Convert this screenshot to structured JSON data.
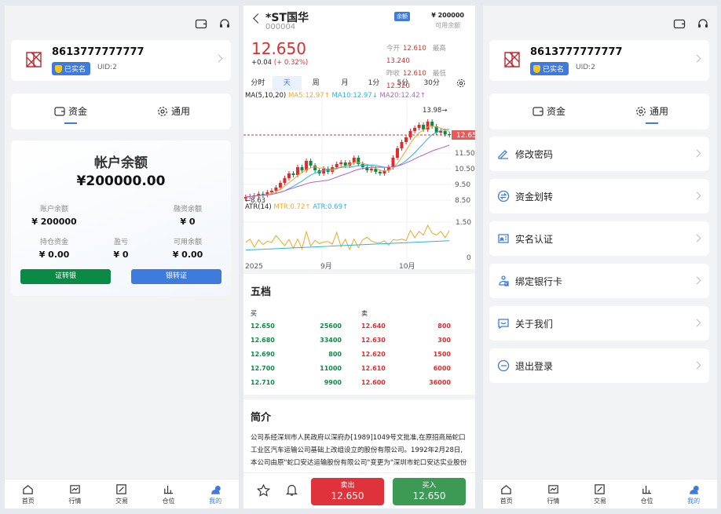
{
  "profile": {
    "phone": "8613777777777",
    "verified": "已实名",
    "uid": "UID:2"
  },
  "tabs": {
    "funds": "资金",
    "general": "通用"
  },
  "balance": {
    "title": "帐户余额",
    "value": "¥200000.00",
    "cells": [
      {
        "label": "账户余额",
        "value": "¥ 200000"
      },
      {
        "label": "融资余额",
        "value": "¥ 0"
      },
      {
        "label": "持仓资金",
        "value": "¥ 0.00"
      },
      {
        "label": "盈亏",
        "value": "¥ 0"
      },
      {
        "label": "可用余额",
        "value": "¥ 0.00"
      }
    ],
    "btn_out": "证转银",
    "btn_in": "银转证",
    "green": "#0b8a45",
    "blue": "#3f7bdc"
  },
  "nav": [
    "首页",
    "行情",
    "交易",
    "仓位",
    "我的"
  ],
  "stock": {
    "name": "*ST国华",
    "code": "000004",
    "tag": "余额",
    "available_amount": "¥ 200000",
    "available_label": "可用余额",
    "price": "12.650",
    "change": "+0.04",
    "change_pct": "(+ 0.32%)",
    "open_label": "今开",
    "open": "12.610",
    "high_label": "最高",
    "high": "13.240",
    "prev_label": "昨收",
    "prev": "12.610",
    "low_label": "最低",
    "low": "12.520"
  },
  "periods": [
    "分时",
    "天",
    "周",
    "月",
    "1分",
    "5分",
    "30分"
  ],
  "legend": {
    "ma": "MA(5,10,20)",
    "ma5": "MA5:12.97↑",
    "ma10": "MA10:12.97↓",
    "ma20": "MA20:12.42↑",
    "atr": "ATR(14)",
    "mtr": "MTR:0.72↑",
    "atr_v": "ATR:0.69↑"
  },
  "chart_data": {
    "type": "candlestick",
    "price_axis": [
      "12.65",
      "11.50",
      "10.50",
      "9.50",
      "8.50"
    ],
    "atr_axis": [
      "1.50",
      "0"
    ],
    "x_labels": [
      "2025",
      "9月",
      "10月"
    ],
    "max_label": "13.98→",
    "min_label": "←8.63",
    "closes": [
      8.7,
      8.75,
      8.8,
      8.9,
      8.85,
      9.0,
      9.1,
      9.3,
      9.6,
      9.9,
      10.2,
      10.1,
      10.6,
      10.4,
      11.0,
      10.7,
      10.4,
      10.2,
      10.5,
      10.3,
      10.6,
      10.8,
      10.9,
      10.7,
      10.9,
      11.2,
      10.8,
      10.6,
      10.4,
      10.5,
      10.3,
      10.2,
      10.4,
      10.6,
      11.2,
      11.8,
      12.2,
      12.5,
      12.9,
      13.1,
      13.3,
      13.0,
      13.5,
      13.2,
      12.8,
      12.9,
      12.7,
      12.65
    ]
  },
  "order_book": {
    "title": "五档",
    "buy_label": "买",
    "sell_label": "卖",
    "bids": [
      {
        "p": "12.650",
        "v": "25600"
      },
      {
        "p": "12.680",
        "v": "33400"
      },
      {
        "p": "12.690",
        "v": "800"
      },
      {
        "p": "12.700",
        "v": "11000"
      },
      {
        "p": "12.710",
        "v": "9900"
      }
    ],
    "asks": [
      {
        "p": "12.640",
        "v": "800"
      },
      {
        "p": "12.630",
        "v": "300"
      },
      {
        "p": "12.620",
        "v": "1500"
      },
      {
        "p": "12.610",
        "v": "6000"
      },
      {
        "p": "12.600",
        "v": "36000"
      }
    ]
  },
  "intro": {
    "title": "简介",
    "text": "公司系经深圳市人民政府以深府办[1989]1049号文批准,在原招商局蛇口工业区汽车运输公司基础上改组设立的股份有限公司。1992年2月28日,本公司由原\"蛇口安达运输股份有限公司\"变更为\"深圳市蛇口安达实业股份"
  },
  "trade": {
    "sell": "卖出",
    "buy": "买入",
    "price": "12.650"
  },
  "menu": [
    "修改密码",
    "资金划转",
    "实名认证",
    "绑定银行卡",
    "关于我们",
    "退出登录"
  ]
}
